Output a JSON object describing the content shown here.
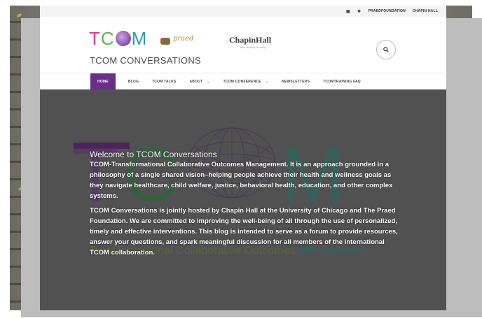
{
  "topbar": {
    "icons": [
      "facebook-icon",
      "twitter-icon"
    ],
    "links": [
      "PRAEDFOUNDATION",
      "CHAPIN HALL"
    ]
  },
  "header": {
    "logo_letters": {
      "t": "T",
      "c": "C",
      "m": "M"
    },
    "praed_logo_text": "praed",
    "chapin_name": "ChapinHall",
    "chapin_sub": "at the University of Chicago",
    "site_title": "TCOM CONVERSATIONS",
    "search_icon": "search-icon"
  },
  "nav": {
    "items": [
      {
        "label": "HOME",
        "active": true
      },
      {
        "label": "BLOG"
      },
      {
        "label": "TCOM TALKS"
      },
      {
        "label": "ABOUT",
        "has_dropdown": true
      },
      {
        "label": "TCOM CONFERENCE",
        "has_dropdown": true
      },
      {
        "label": "NEWSLETTERS"
      },
      {
        "label": "TCOMTRAINING FAQ"
      }
    ]
  },
  "hero": {
    "bg_logo": {
      "t": "T",
      "c": "C",
      "m": "M"
    },
    "bg_subtitle": "Transformational Collaborative Outcomes",
    "bg_subtitle_end": "Management",
    "heading": "Welcome to TCOM Conversations",
    "paragraph1": "TCOM-Transformational Collaborative Outcomes Management. It is an approach grounded in a philosophy of a single shared vision–helping people achieve their health and wellness goals as they navigate healthcare, child welfare, justice, behavioral health, education, and other complex systems.",
    "paragraph2": "TCOM Conversations is jointly hosted by Chapin Hall at the University of Chicago and The Praed Foundation. We are committed to improving the well-being of all through the use of personalized, timely and effective interventions. This blog is intended to serve as a forum to provide resources, answer your questions, and spark meaningful discussion for all members of the international TCOM collaboration."
  },
  "colors": {
    "nav_active": "#6b2f86",
    "hero_bg": "#515151",
    "logo_t": "#d63b8f",
    "logo_c": "#5fb54a",
    "logo_m": "#2ba0a8"
  }
}
